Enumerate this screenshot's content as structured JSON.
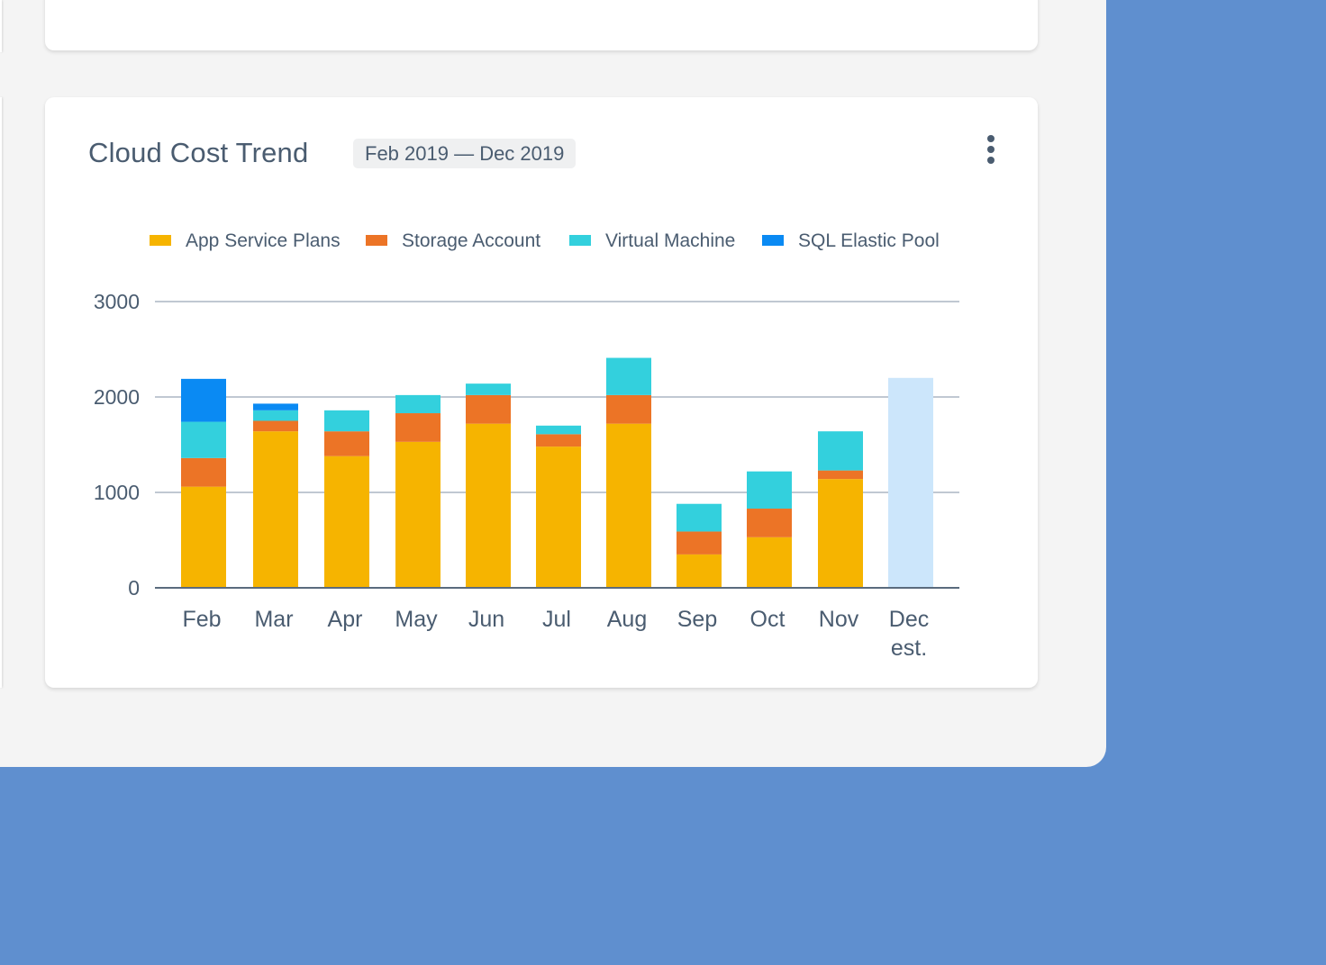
{
  "card": {
    "title": "Cloud Cost Trend",
    "date_range": "Feb 2019 — Dec 2019",
    "menu_icon": "vertical-ellipsis-icon"
  },
  "colors": {
    "page_background": "#5f8fcf",
    "surface": "#f4f4f4",
    "card": "#ffffff",
    "text": "#4a5c70",
    "gridline": "#9aa8b6",
    "estimate": "#cce6fb"
  },
  "chart_data": {
    "type": "bar",
    "stacked": true,
    "categories": [
      "Feb",
      "Mar",
      "Apr",
      "May",
      "Jun",
      "Jul",
      "Aug",
      "Sep",
      "Oct",
      "Nov",
      "Dec\nest."
    ],
    "series": [
      {
        "name": "App Service Plans",
        "color": "#f6b400",
        "values": [
          1060,
          1640,
          1380,
          1530,
          1720,
          1480,
          1720,
          350,
          530,
          1140,
          0
        ]
      },
      {
        "name": "Storage Account",
        "color": "#ec7426",
        "values": [
          300,
          110,
          260,
          300,
          300,
          130,
          300,
          240,
          300,
          90,
          0
        ]
      },
      {
        "name": "Virtual Machine",
        "color": "#33d0dd",
        "values": [
          380,
          110,
          220,
          190,
          120,
          90,
          390,
          290,
          390,
          410,
          0
        ]
      },
      {
        "name": "SQL Elastic Pool",
        "color": "#0a8af3",
        "values": [
          450,
          70,
          0,
          0,
          0,
          0,
          0,
          0,
          0,
          0,
          0
        ]
      }
    ],
    "estimate": {
      "category": "Dec\nest.",
      "value": 2200,
      "color": "#cce6fb"
    },
    "y_ticks": [
      0,
      1000,
      2000,
      3000
    ],
    "ylim": [
      0,
      3000
    ],
    "grid": true,
    "legend_position": "top",
    "title": "",
    "xlabel": "",
    "ylabel": ""
  }
}
